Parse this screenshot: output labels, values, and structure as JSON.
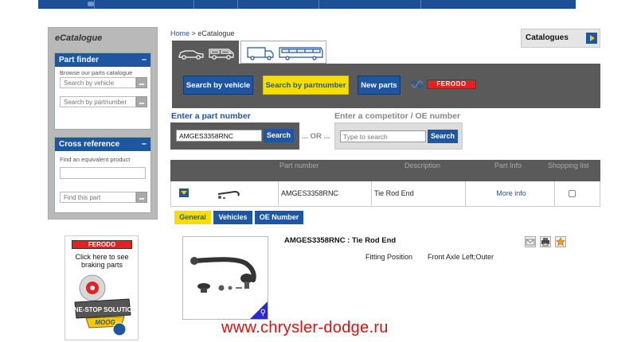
{
  "sidebar": {
    "title": "eCatalogue",
    "part_finder": {
      "title": "Part finder",
      "toggle": "–",
      "text": "Browse our parts catalogue",
      "vehicle_placeholder": "Search by vehicle",
      "partnumber_placeholder": "Search by partnumber"
    },
    "cross_reference": {
      "title": "Cross reference",
      "toggle": "–",
      "text": "Find an equivalent product",
      "find_label": "Find this part"
    },
    "promo": {
      "brand": "FERODO",
      "text": "Click here to see braking parts",
      "badge_line1": "ONE-STOP SOLUTION",
      "badge_brand": "MOOG"
    }
  },
  "breadcrumb": {
    "home": "Home",
    "separator": ">",
    "current": "eCatalogue"
  },
  "catalogues_label": "Catalogues",
  "search_tabs": {
    "by_vehicle": "Search by vehicle",
    "by_partnumber": "Search by partnumber",
    "new_parts": "New parts",
    "brand": "FERODO"
  },
  "part_search": {
    "label": "Enter a part number",
    "value": "AMGES3358RNC",
    "button": "Search",
    "or": "... OR ..."
  },
  "competitor_search": {
    "label": "Enter a competitor / OE number",
    "placeholder": "Type to search",
    "button": "Search"
  },
  "results": {
    "headers": [
      "Part number",
      "Description",
      "Part Info",
      "Shopping list"
    ],
    "rows": [
      {
        "part_number": "AMGES3358RNC",
        "description": "Tie Rod End",
        "info": "More info"
      }
    ]
  },
  "detail": {
    "tabs": [
      "General",
      "Vehicles",
      "OE Number"
    ],
    "title": "AMGES3358RNC : Tie Rod End",
    "fitting_label": "Fitting Position",
    "fitting_value": "Front Axle Left;Outer"
  },
  "watermark": "www.chrysler-dodge.ru",
  "colors": {
    "brand_blue": "#1f56a2",
    "highlight_yellow": "#f6df00",
    "bar_gray": "#5a5a5a",
    "ferodo_red": "#e62020"
  }
}
